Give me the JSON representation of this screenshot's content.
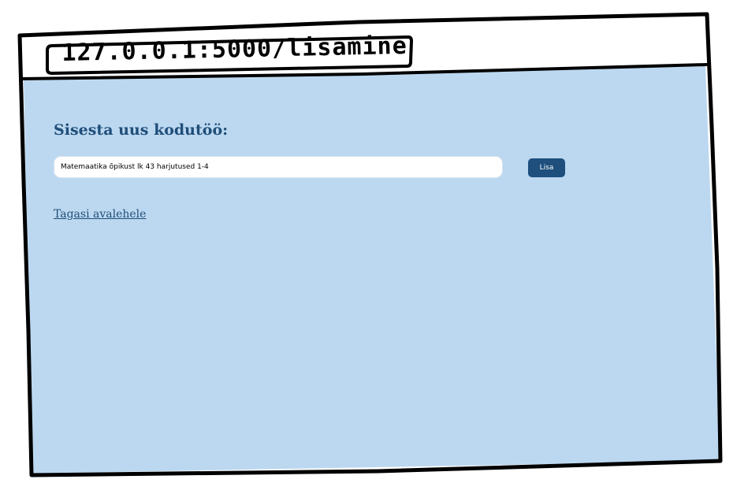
{
  "browser": {
    "url": "127.0.0.1:5000/lisamine"
  },
  "page": {
    "heading": "Sisesta uus kodutöö:",
    "task_input": {
      "value": "Matemaatika õpikust lk 43 harjutused 1-4"
    },
    "add_button_label": "Lisa",
    "back_link_label": "Tagasi avalehele"
  },
  "colors": {
    "page_background": "#bcd8f0",
    "heading": "#1f4e79",
    "button": "#1e4f7d",
    "frame_stroke": "#000000"
  }
}
